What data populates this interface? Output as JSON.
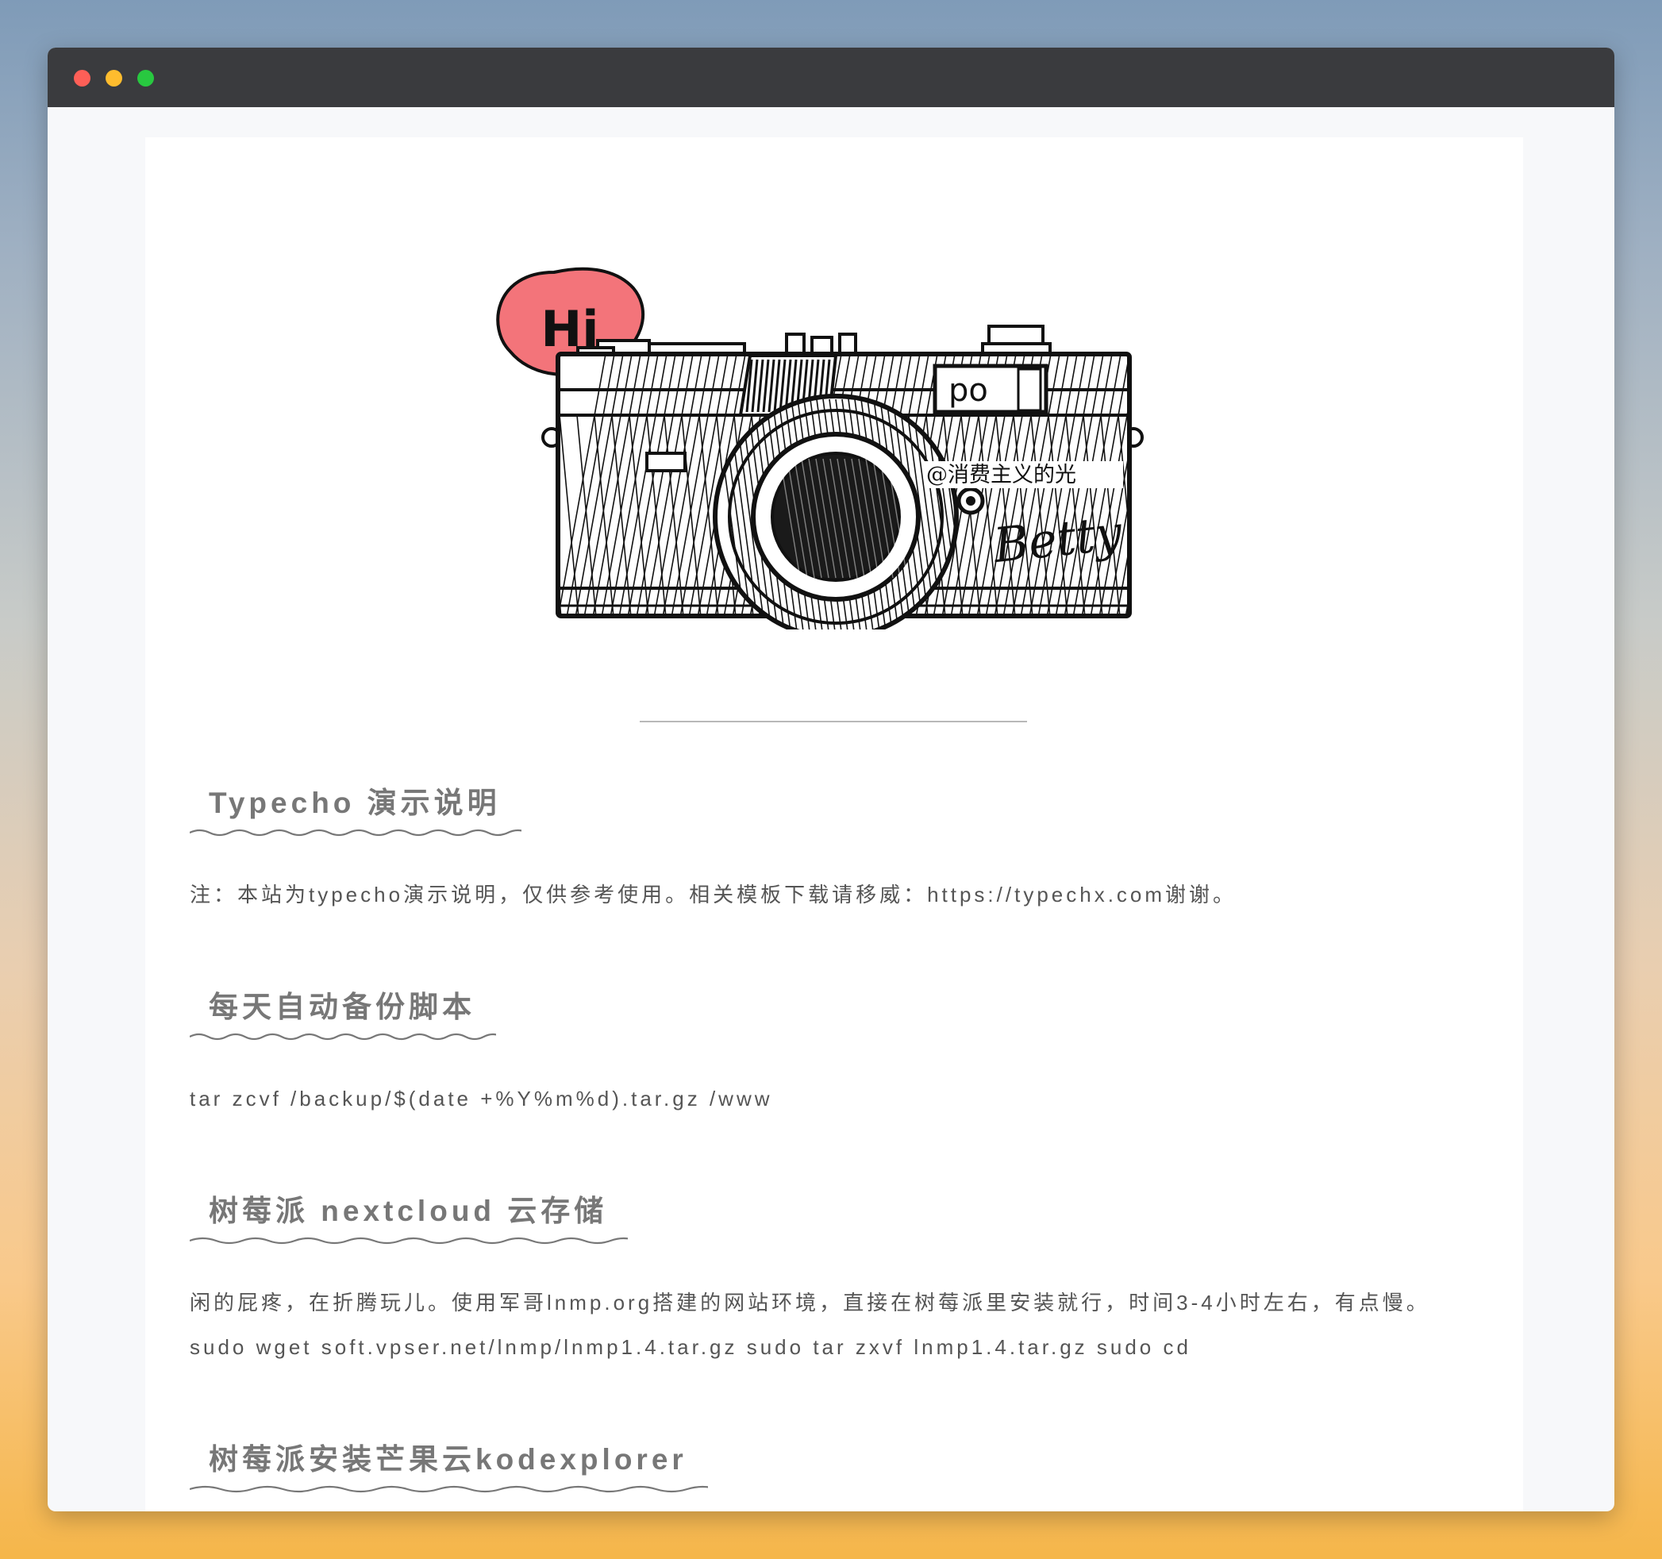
{
  "window": {
    "buttons": {
      "close": "red",
      "minimize": "yellow",
      "maximize": "green"
    }
  },
  "hero": {
    "bubble_text": "Hi",
    "watermark": "@消费主义的光",
    "signature": "Betty"
  },
  "posts": [
    {
      "title": "Typecho 演示说明",
      "excerpt": "注：本站为typecho演示说明，仅供参考使用。相关模板下载请移威：https://typechx.com谢谢。"
    },
    {
      "title": "每天自动备份脚本",
      "excerpt": "tar zcvf /backup/$(date +%Y%m%d).tar.gz /www"
    },
    {
      "title": "树莓派 nextcloud 云存储",
      "excerpt": "闲的屁疼，在折腾玩儿。使用军哥lnmp.org搭建的网站环境，直接在树莓派里安装就行，时间3-4小时左右，有点慢。sudo wget soft.vpser.net/lnmp/lnmp1.4.tar.gz sudo tar zxvf lnmp1.4.tar.gz sudo cd"
    },
    {
      "title": "树莓派安装芒果云kodexplorer",
      "excerpt": ""
    }
  ],
  "colors": {
    "titlebar": "#3a3b3e",
    "bubble": "#f3747a",
    "heading": "#777777",
    "text": "#555555"
  }
}
